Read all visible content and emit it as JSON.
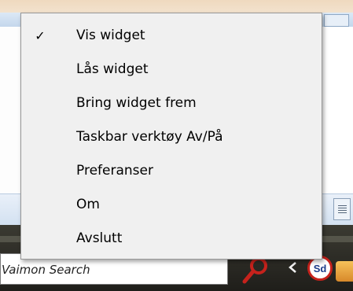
{
  "menu": {
    "items": [
      {
        "label": "Vis widget",
        "check": "✓"
      },
      {
        "label": "Lås widget",
        "check": ""
      },
      {
        "label": "Bring widget frem",
        "check": ""
      },
      {
        "label": "Taskbar verktøy Av/På",
        "check": ""
      },
      {
        "label": "Preferanser",
        "check": ""
      },
      {
        "label": "Om",
        "check": ""
      },
      {
        "label": "Avslutt",
        "check": ""
      }
    ]
  },
  "taskbar": {
    "search_text": "Vaimon Search",
    "search_icon": "search-icon",
    "chevron_icon": "chevron-left-icon",
    "tray_badge_text": "Sd",
    "tray_badge_color": "#c6221c",
    "search_icon_color": "#c6221c"
  },
  "colors": {
    "menu_background": "#f0f0f0",
    "menu_border": "#979797",
    "taskbar": "#2c2b26"
  }
}
